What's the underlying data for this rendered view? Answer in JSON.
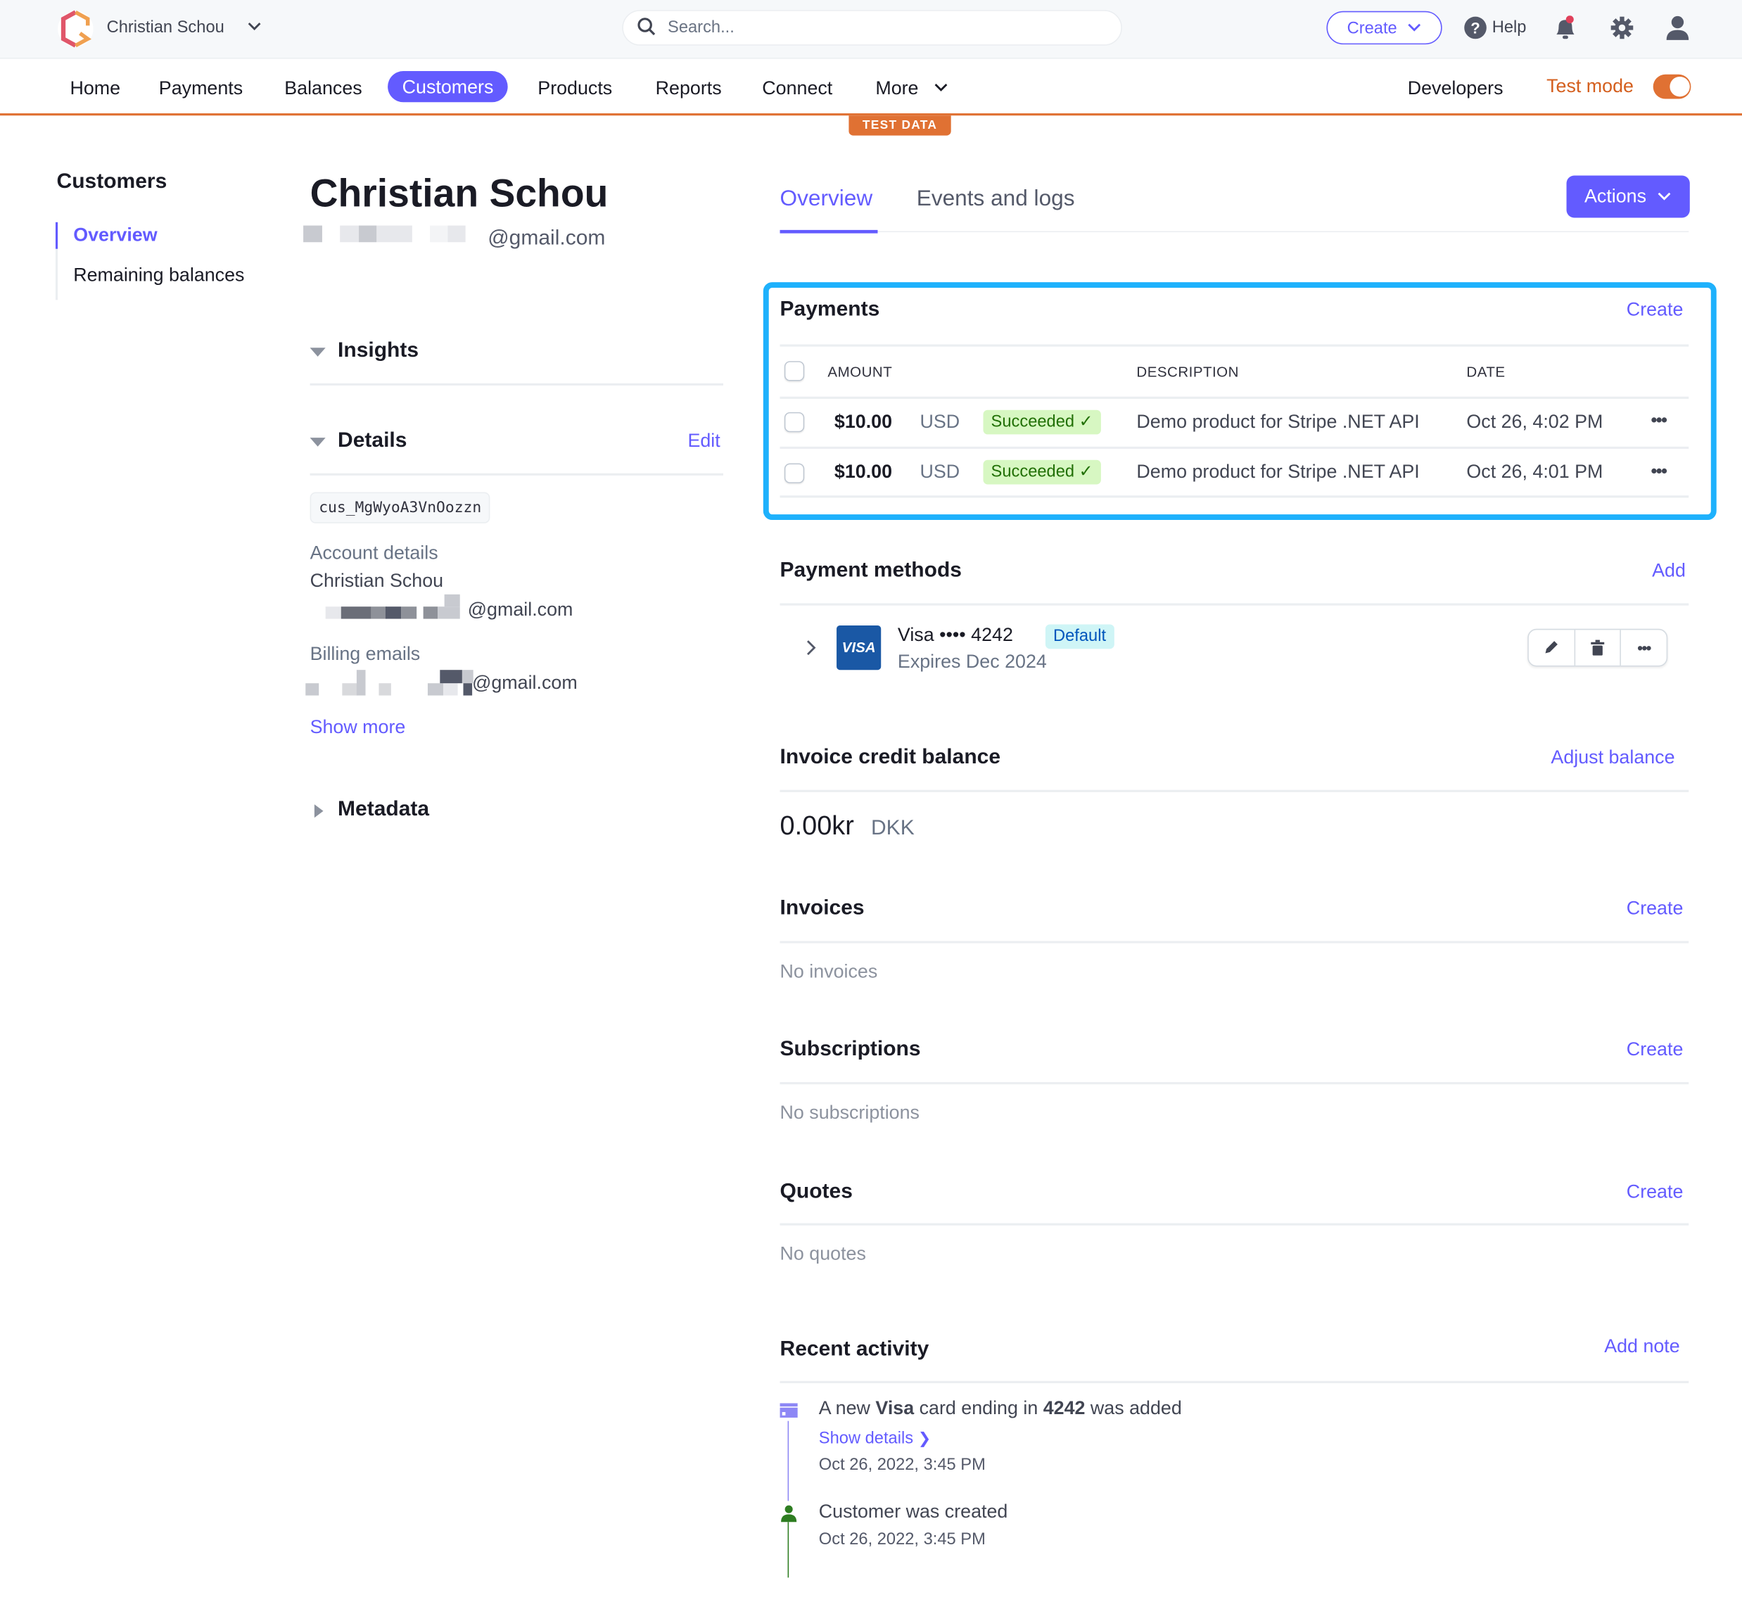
{
  "topbar": {
    "account_name": "Christian Schou",
    "search_placeholder": "Search...",
    "create_label": "Create",
    "help_label": "Help"
  },
  "nav": {
    "items": [
      "Home",
      "Payments",
      "Balances",
      "Customers",
      "Products",
      "Reports",
      "Connect",
      "More"
    ],
    "active": "Customers",
    "developers_label": "Developers",
    "test_mode_label": "Test mode",
    "test_mode_on": true,
    "test_data_badge": "TEST DATA"
  },
  "sidebar": {
    "title": "Customers",
    "items": [
      {
        "label": "Overview",
        "active": true
      },
      {
        "label": "Remaining balances",
        "active": false
      }
    ]
  },
  "customer": {
    "name": "Christian Schou",
    "email_suffix": "@gmail.com",
    "insights_label": "Insights",
    "details_label": "Details",
    "edit_label": "Edit",
    "customer_id": "cus_MgWyoA3VnOozzn",
    "account_details_label": "Account details",
    "account_name": "Christian Schou",
    "account_email_suffix": "@gmail.com",
    "billing_emails_label": "Billing emails",
    "billing_email_suffix": "@gmail.com",
    "show_more_label": "Show more",
    "metadata_label": "Metadata"
  },
  "tabs": [
    {
      "label": "Overview",
      "active": true
    },
    {
      "label": "Events and logs",
      "active": false
    }
  ],
  "actions_label": "Actions",
  "payments": {
    "title": "Payments",
    "create_label": "Create",
    "columns": [
      "AMOUNT",
      "DESCRIPTION",
      "DATE"
    ],
    "rows": [
      {
        "amount": "$10.00",
        "currency": "USD",
        "status": "Succeeded",
        "description": "Demo product for Stripe .NET API",
        "date": "Oct 26, 4:02 PM"
      },
      {
        "amount": "$10.00",
        "currency": "USD",
        "status": "Succeeded",
        "description": "Demo product for Stripe .NET API",
        "date": "Oct 26, 4:01 PM"
      }
    ]
  },
  "payment_methods": {
    "title": "Payment methods",
    "add_label": "Add",
    "card_brand_logo": "VISA",
    "card_label": "Visa •••• 4242",
    "default_badge": "Default",
    "expires": "Expires Dec 2024"
  },
  "credit_balance": {
    "title": "Invoice credit balance",
    "adjust_label": "Adjust balance",
    "amount": "0.00kr",
    "currency": "DKK"
  },
  "invoices": {
    "title": "Invoices",
    "create_label": "Create",
    "empty": "No invoices"
  },
  "subscriptions": {
    "title": "Subscriptions",
    "create_label": "Create",
    "empty": "No subscriptions"
  },
  "quotes": {
    "title": "Quotes",
    "create_label": "Create",
    "empty": "No quotes"
  },
  "recent_activity": {
    "title": "Recent activity",
    "add_note_label": "Add note",
    "items": [
      {
        "pre": "A new ",
        "b1": "Visa",
        "mid": " card ending in ",
        "b2": "4242",
        "post": " was added",
        "link": "Show details",
        "date": "Oct 26, 2022, 3:45 PM"
      },
      {
        "text": "Customer was created",
        "date": "Oct 26, 2022, 3:45 PM"
      }
    ]
  },
  "colors": {
    "accent": "#635bff",
    "test_mode": "#e07133",
    "highlight": "#1eb1fc",
    "success_bg": "#d7f7c2",
    "success_text": "#217005"
  }
}
